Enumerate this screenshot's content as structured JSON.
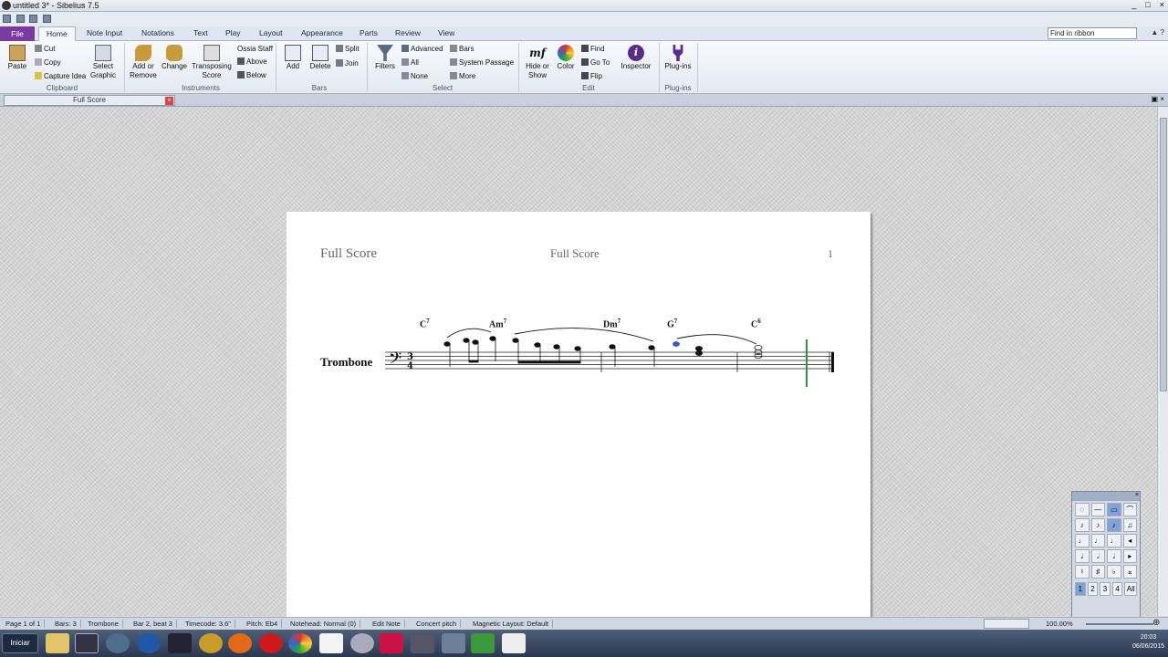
{
  "window": {
    "title": "untitled 3* - Sibelius 7.5",
    "min": "_",
    "max": "□",
    "close": "×"
  },
  "ribbon_tabs": [
    "File",
    "Home",
    "Note Input",
    "Notations",
    "Text",
    "Play",
    "Layout",
    "Appearance",
    "Parts",
    "Review",
    "View"
  ],
  "find_in_ribbon": "Find in ribbon",
  "clipboard": {
    "paste": "Paste",
    "cut": "Cut",
    "copy": "Copy",
    "capture_idea": "Capture Idea",
    "select_graphic_1": "Select",
    "select_graphic_2": "Graphic",
    "group": "Clipboard"
  },
  "instruments": {
    "add1": "Add or",
    "add2": "Remove",
    "change": "Change",
    "transp1": "Transposing",
    "transp2": "Score",
    "ossia": "Ossia Staff",
    "above": "Above",
    "below": "Below",
    "group": "Instruments"
  },
  "bars": {
    "add": "Add",
    "delete": "Delete",
    "split": "Split",
    "join": "Join",
    "group": "Bars"
  },
  "select": {
    "filters": "Filters",
    "advanced": "Advanced",
    "all": "All",
    "none": "None",
    "bars": "Bars",
    "system_passage": "System Passage",
    "more": "More",
    "group": "Select"
  },
  "edit": {
    "hide1": "Hide or",
    "hide2": "Show",
    "color": "Color",
    "find": "Find",
    "goto": "Go To",
    "flip": "Flip",
    "inspector": "Inspector",
    "group": "Edit"
  },
  "plugins": {
    "label": "Plug-ins",
    "group": "Plug-ins"
  },
  "doc_tab": "Full Score",
  "page": {
    "header_left": "Full Score",
    "header_center": "Full Score",
    "page_number": "1",
    "instrument": "Trombone",
    "chords": [
      {
        "root": "C",
        "ext": "7"
      },
      {
        "root": "Am",
        "ext": "7"
      },
      {
        "root": "Dm",
        "ext": "7"
      },
      {
        "root": "G",
        "ext": "7"
      },
      {
        "root": "C",
        "ext": "6"
      }
    ],
    "time_sig_top": "3",
    "time_sig_bottom": "4"
  },
  "status_bar": [
    "Page 1 of 1",
    "Bars: 3",
    "Trombone",
    "Bar 2, beat 3",
    "Timecode: 3.6\"",
    "Pitch: Eb4",
    "Notehead: Normal (0)",
    "Edit Note",
    "Concert pitch",
    "Magnetic Layout: Default"
  ],
  "zoom": "100.00%",
  "taskbar": {
    "start": "Iniciar",
    "time": "20:03",
    "date": "06/06/2015"
  },
  "keypad_tabs": [
    "1",
    "2",
    "3",
    "4",
    "All"
  ]
}
